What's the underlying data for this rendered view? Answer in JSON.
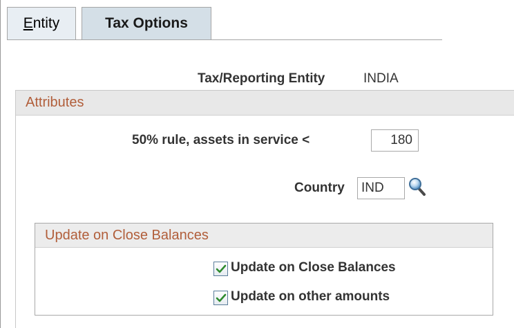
{
  "tabs": [
    {
      "label": "Entity",
      "mnemonic": "E",
      "rest": "ntity"
    },
    {
      "label": "Tax Options"
    }
  ],
  "entity": {
    "label": "Tax/Reporting Entity",
    "value": "INDIA"
  },
  "attributes": {
    "title": "Attributes",
    "rule_label": "50% rule, assets in service <",
    "rule_value": "180",
    "country_label": "Country",
    "country_value": "IND",
    "lookup_icon": "magnifier-icon"
  },
  "close_balances": {
    "title": "Update on Close Balances",
    "checkboxes": [
      {
        "label": "Update on Close Balances",
        "checked": true
      },
      {
        "label": "Update on other amounts",
        "checked": true
      }
    ]
  },
  "colors": {
    "section_title": "#b15e3a",
    "tab_active": "#d4dfe7",
    "tab_inactive": "#e8eef3",
    "check_mark": "#2e8b2e"
  }
}
